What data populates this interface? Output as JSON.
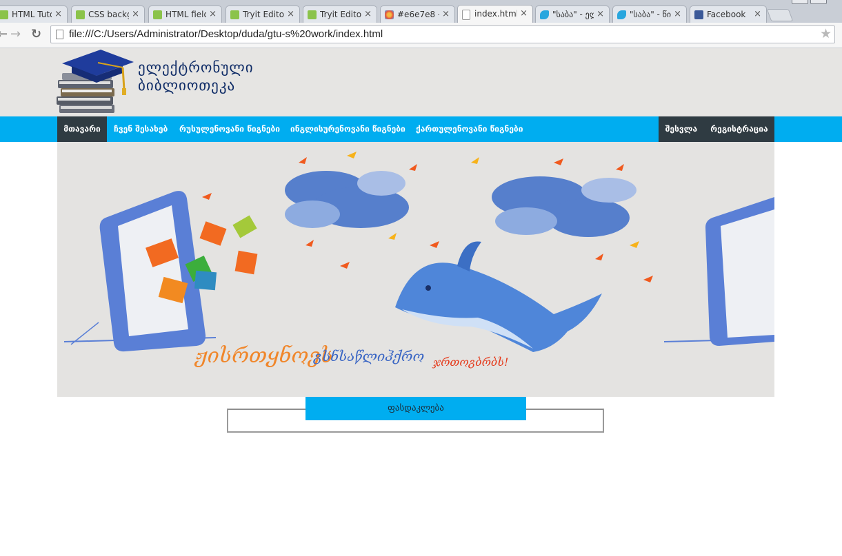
{
  "browser": {
    "tabs": [
      {
        "label": "HTML Tuto",
        "icon": "w3schools-icon",
        "active": false
      },
      {
        "label": "CSS backgr",
        "icon": "w3schools-icon",
        "active": false
      },
      {
        "label": "HTML field",
        "icon": "w3schools-icon",
        "active": false
      },
      {
        "label": "Tryit Editor",
        "icon": "w3schools-icon",
        "active": false
      },
      {
        "label": "Tryit Editor",
        "icon": "w3schools-icon",
        "active": false
      },
      {
        "label": "#e6e7e8 —",
        "icon": "palette-icon",
        "active": false
      },
      {
        "label": "index.html",
        "icon": "page-icon",
        "active": true
      },
      {
        "label": "\"საბა\" - ელ",
        "icon": "saba-icon",
        "active": false
      },
      {
        "label": "\"საბა\" - წიგ",
        "icon": "saba-icon",
        "active": false
      },
      {
        "label": "Facebook",
        "icon": "facebook-icon",
        "active": false
      }
    ],
    "close_glyph": "×",
    "back_glyph": "←",
    "forward_glyph": "→",
    "reload_glyph": "↻",
    "star_glyph": "★",
    "url": "file:///C:/Users/Administrator/Desktop/duda/gtu-s%20work/index.html"
  },
  "site": {
    "title_line1": "ელექტრონული",
    "title_line2": "ბიბლიოთეკა",
    "nav_left": [
      "მთავარი",
      "ჩვენ შესახებ",
      "რუსულენოვანი წიგნები",
      "ინგლისურენოვანი წიგნები",
      "ქართულენოვანი წიგნები"
    ],
    "nav_right": [
      "შესვლა",
      "რეგისტრაცია"
    ],
    "banner": {
      "slogan_part1": "ჟისრთყნოეს",
      "slogan_part2": "გსნსაწლიჰქრო",
      "slogan_part3": "ჯრთოგბრბს!"
    },
    "pricing_legend": "ფასდაკლება"
  },
  "colors": {
    "header_bg": "#e6e5e3",
    "nav_bg": "#00adf0",
    "nav_active_bg": "#2f3b42",
    "banner_bg": "#e4e3e1",
    "title_color": "#0e2b66"
  }
}
